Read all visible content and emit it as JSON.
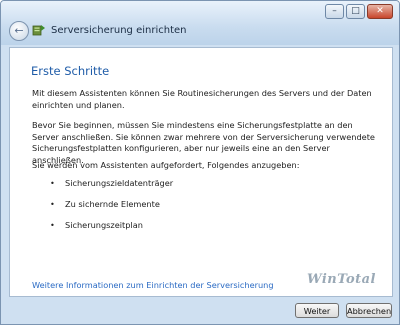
{
  "window": {
    "title": "Serversicherung einrichten",
    "caption_buttons": {
      "minimize": "–",
      "maximize": "□",
      "close": "✕"
    }
  },
  "content": {
    "heading": "Erste Schritte",
    "paragraphs": [
      "Mit diesem Assistenten können Sie Routinesicherungen des Servers und der Daten einrichten und planen.",
      "Bevor Sie beginnen, müssen Sie mindestens eine Sicherungsfestplatte an den Server anschließen. Sie können zwar mehrere von der Serversicherung verwendete Sicherungsfestplatten konfigurieren, aber nur jeweils eine an den Server anschließen.",
      "Sie werden vom Assistenten aufgefordert, Folgendes anzugeben:"
    ],
    "steps": [
      "Sicherungszieldatenträger",
      "Zu sichernde Elemente",
      "Sicherungszeitplan"
    ],
    "more_info_link": "Weitere Informationen zum Einrichten der Serversicherung"
  },
  "watermark": "WinTotal",
  "buttons": {
    "next": "Weiter",
    "cancel": "Abbrechen"
  },
  "icons": {
    "back": "back-arrow-icon",
    "wizard": "server-backup-icon",
    "bullet": "•"
  }
}
